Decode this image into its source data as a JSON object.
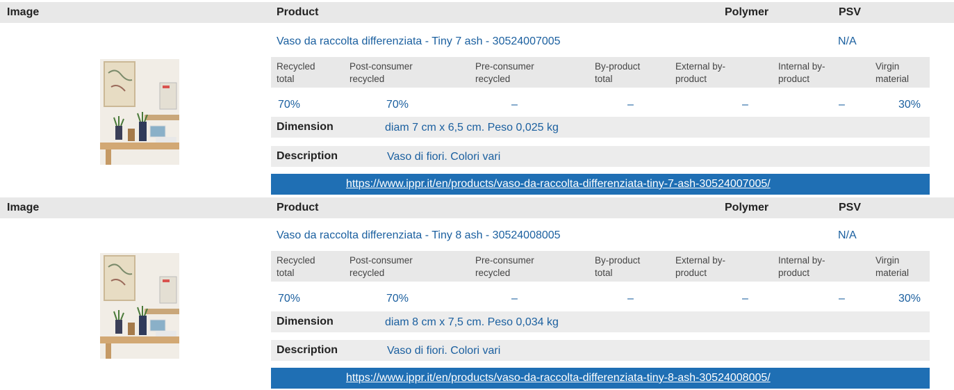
{
  "headers": {
    "image": "Image",
    "product": "Product",
    "polymer": "Polymer",
    "psv": "PSV"
  },
  "products": [
    {
      "name": "Vaso da raccolta differenziata - Tiny 7 ash - 30524007005",
      "psv": "N/A",
      "composition_labels": [
        "Recycled total",
        "Post-consumer recycled",
        "Pre-consumer recycled",
        "By-product total",
        "External by-product",
        "Internal by-product",
        "Virgin material"
      ],
      "composition_values": [
        "70%",
        "70%",
        "–",
        "–",
        "–",
        "–",
        "30%"
      ],
      "dimension_label": "Dimension",
      "dimension": "diam 7 cm x 6,5 cm. Peso 0,025 kg",
      "description_label": "Description",
      "description": "Vaso di fiori. Colori vari",
      "url": "https://www.ippr.it/en/products/vaso-da-raccolta-differenziata-tiny-7-ash-30524007005/"
    },
    {
      "name": "Vaso da raccolta differenziata - Tiny 8 ash - 30524008005",
      "psv": "N/A",
      "composition_labels": [
        "Recycled total",
        "Post-consumer recycled",
        "Pre-consumer recycled",
        "By-product total",
        "External by-product",
        "Internal by-product",
        "Virgin material"
      ],
      "composition_values": [
        "70%",
        "70%",
        "–",
        "–",
        "–",
        "–",
        "30%"
      ],
      "dimension_label": "Dimension",
      "dimension": "diam 8 cm x 7,5 cm. Peso 0,034 kg",
      "description_label": "Description",
      "description": "Vaso di fiori. Colori vari",
      "url": "https://www.ippr.it/en/products/vaso-da-raccolta-differenziata-tiny-8-ash-30524008005/"
    }
  ]
}
